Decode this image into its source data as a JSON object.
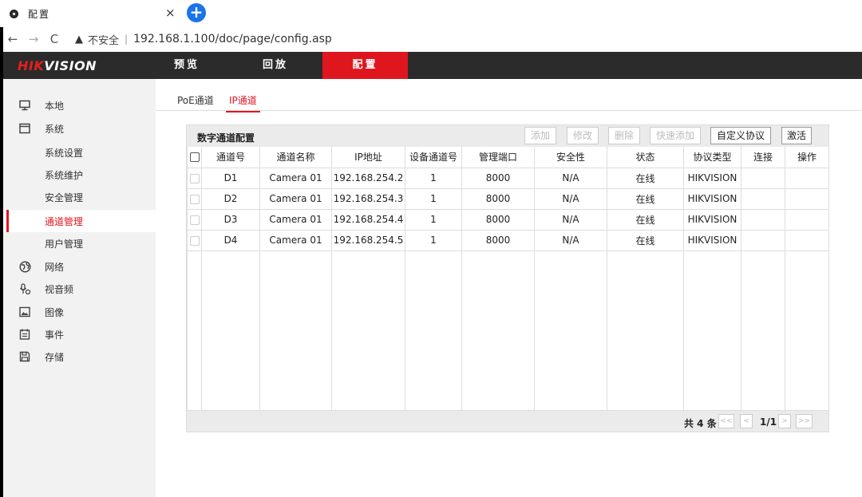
{
  "browser": {
    "tab_title": "配置",
    "tab_close": "×",
    "new_tab": "+",
    "back": "←",
    "forward": "→",
    "reload": "C",
    "warning_icon": "▲",
    "insecure_label": "不安全",
    "separator": "|",
    "url": "192.168.1.100/doc/page/config.asp"
  },
  "header": {
    "logo_red": "HIK",
    "logo_white": "VISION",
    "nav": [
      "预览",
      "回放",
      "配置"
    ],
    "active_nav": "配置"
  },
  "sidebar": {
    "items": [
      {
        "label": "本地",
        "icon": "monitor-icon"
      },
      {
        "label": "系统",
        "icon": "window-icon"
      },
      {
        "label": "系统设置"
      },
      {
        "label": "系统维护"
      },
      {
        "label": "安全管理"
      },
      {
        "label": "通道管理",
        "active": true
      },
      {
        "label": "用户管理"
      },
      {
        "label": "网络",
        "icon": "globe-icon"
      },
      {
        "label": "视音频",
        "icon": "microphone-icon"
      },
      {
        "label": "图像",
        "icon": "image-icon"
      },
      {
        "label": "事件",
        "icon": "calendar-icon"
      },
      {
        "label": "存储",
        "icon": "save-icon"
      }
    ]
  },
  "subtabs": [
    "PoE通道",
    "IP通道"
  ],
  "active_subtab": "IP通道",
  "panel": {
    "title": "数字通道配置",
    "buttons": {
      "add": "添加",
      "modify": "修改",
      "delete": "删除",
      "quick_add": "快速添加",
      "custom_protocol": "自定义协议",
      "activate": "激活"
    },
    "columns": [
      "通道号",
      "通道名称",
      "IP地址",
      "设备通道号",
      "管理端口",
      "安全性",
      "状态",
      "协议类型",
      "连接",
      "操作"
    ],
    "rows": [
      {
        "ch": "D1",
        "name": "Camera 01",
        "ip": "192.168.254.2",
        "dev_ch": "1",
        "port": "8000",
        "security": "N/A",
        "status": "在线",
        "protocol": "HIKVISION"
      },
      {
        "ch": "D2",
        "name": "Camera 01",
        "ip": "192.168.254.3",
        "dev_ch": "1",
        "port": "8000",
        "security": "N/A",
        "status": "在线",
        "protocol": "HIKVISION"
      },
      {
        "ch": "D3",
        "name": "Camera 01",
        "ip": "192.168.254.4",
        "dev_ch": "1",
        "port": "8000",
        "security": "N/A",
        "status": "在线",
        "protocol": "HIKVISION"
      },
      {
        "ch": "D4",
        "name": "Camera 01",
        "ip": "192.168.254.5",
        "dev_ch": "1",
        "port": "8000",
        "security": "N/A",
        "status": "在线",
        "protocol": "HIKVISION"
      }
    ],
    "footer": {
      "total": "共 4 条",
      "first": "<<",
      "prev": "<",
      "page": "1/1",
      "next": ">",
      "last": ">>"
    }
  }
}
